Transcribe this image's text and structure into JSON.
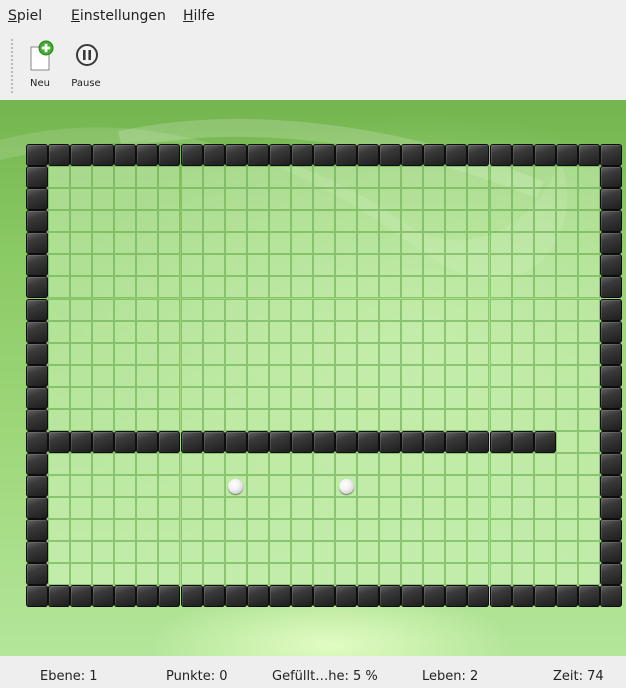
{
  "menu": [
    {
      "name": "spiel",
      "accel": "S",
      "rest": "piel"
    },
    {
      "name": "einstellungen",
      "accel": "E",
      "rest": "instellungen"
    },
    {
      "name": "hilfe",
      "accel": "H",
      "rest": "ilfe"
    }
  ],
  "toolbar": {
    "new_label": "Neu",
    "new_icon": "document-new-icon",
    "pause_label": "Pause",
    "pause_icon": "pause-icon"
  },
  "game": {
    "columns": 27,
    "rows": 21,
    "filled_cells": {
      "top_row": 0,
      "bottom_row": 20,
      "left_column": 0,
      "right_column": 26,
      "partial_wall": {
        "row": 13,
        "from_column": 0,
        "to_column": 23
      }
    },
    "balls": [
      {
        "column": 9,
        "row": 15
      },
      {
        "column": 14,
        "row": 15
      }
    ]
  },
  "status": {
    "level": "Ebene: 1",
    "points": "Punkte: 0",
    "filled": "Gefüllt…he: 5 %",
    "lives": "Leben: 2",
    "time": "Zeit: 74"
  },
  "colors": {
    "background_green": "#8ccb66",
    "grid_line": "#5fa546",
    "tile_dark": "#2a2a2a"
  }
}
